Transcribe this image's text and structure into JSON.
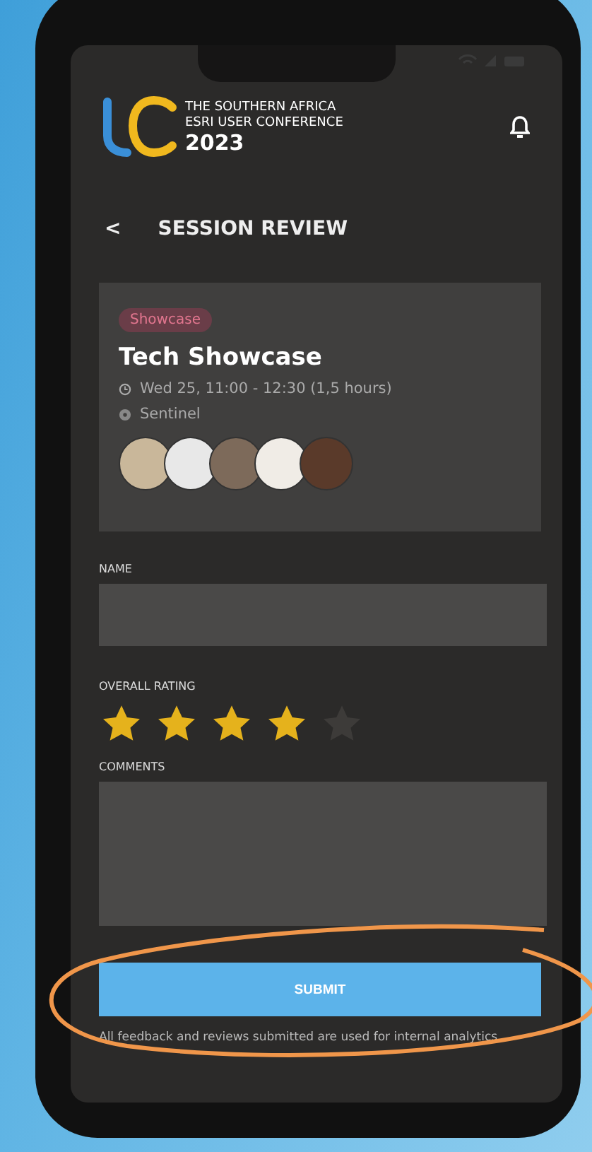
{
  "header": {
    "logo_lines": [
      "THE SOUTHERN AFRICA",
      "ESRI USER CONFERENCE",
      "2023"
    ]
  },
  "nav": {
    "back": "<",
    "title": "SESSION REVIEW"
  },
  "session": {
    "tag": "Showcase",
    "title": "Tech Showcase",
    "time": "Wed 25, 11:00 - 12:30 (1,5 hours)",
    "location": "Sentinel"
  },
  "form": {
    "name_label": "NAME",
    "rating_label": "OVERALL RATING",
    "stars": 4,
    "comments_label": "COMMENTS",
    "submit": "SUBMIT"
  },
  "footnote": "All feedback and reviews submitted are used for internal analytics"
}
